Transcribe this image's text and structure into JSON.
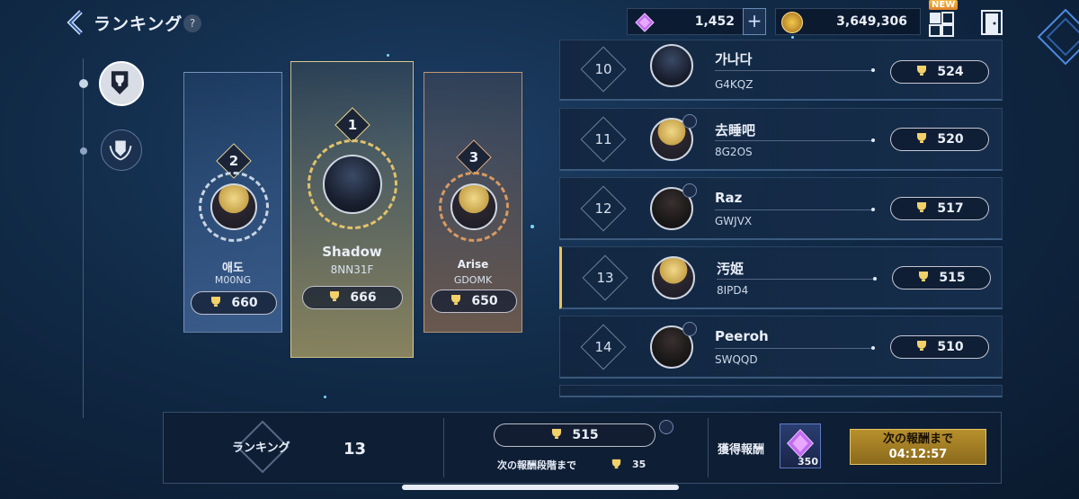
{
  "header": {
    "title": "ランキング",
    "help_label": "?",
    "gems": "1,452",
    "gold": "3,649,306",
    "new_badge": "NEW"
  },
  "podium": [
    {
      "rank": "2",
      "name": "애도",
      "code": "M00NG",
      "score": "660"
    },
    {
      "rank": "1",
      "name": "Shadow",
      "code": "8NN31F",
      "score": "666"
    },
    {
      "rank": "3",
      "name": "Arise",
      "code": "GDOMK",
      "score": "650"
    }
  ],
  "list": [
    {
      "rank": "10",
      "name": "가나다",
      "code": "G4KQZ",
      "score": "524"
    },
    {
      "rank": "11",
      "name": "去睡吧",
      "code": "8G2OS",
      "score": "520"
    },
    {
      "rank": "12",
      "name": "Raz",
      "code": "GWJVX",
      "score": "517"
    },
    {
      "rank": "13",
      "name": "汚姫",
      "code": "8IPD4",
      "score": "515"
    },
    {
      "rank": "14",
      "name": "Peeroh",
      "code": "SWQQD",
      "score": "510"
    }
  ],
  "bottom": {
    "ranking_label": "ランキング",
    "my_rank": "13",
    "my_score": "515",
    "next_tier_label": "次の報酬段階まで",
    "next_tier_value": "35",
    "reward_label": "獲得報酬",
    "reward_amount": "350",
    "timer_label": "次の報酬まで",
    "timer_value": "04:12:57"
  },
  "colors": {
    "gold_accent": "#e7c35a",
    "panel_bg": "#0e1e34",
    "gem_purple": "#c06cf2"
  }
}
